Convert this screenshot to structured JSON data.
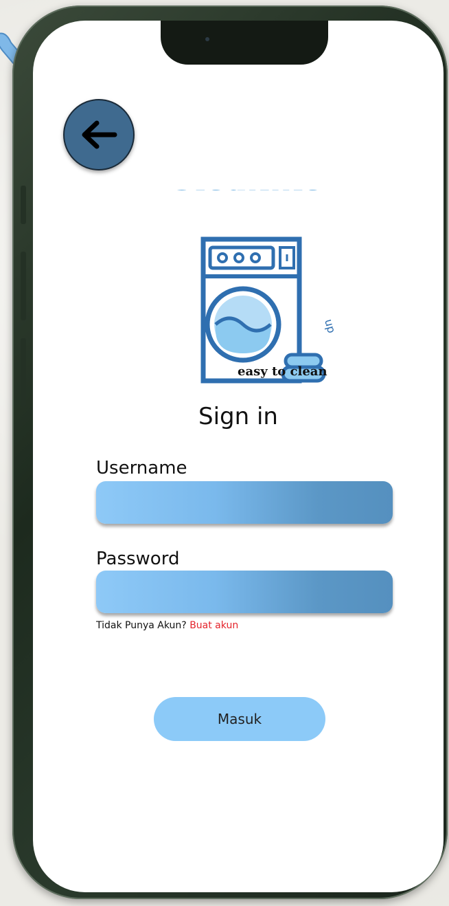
{
  "logo": {
    "wordmark": "Cleanme",
    "wordmark_suffix": "up",
    "tagline": "easy to clean"
  },
  "form": {
    "title": "Sign in",
    "username_label": "Username",
    "username_value": "",
    "password_label": "Password",
    "password_value": "",
    "no_account_text": "Tidak Punya Akun?",
    "create_account_link": "Buat akun",
    "submit_label": "Masuk"
  },
  "icons": {
    "back": "arrow-left-icon",
    "notch_camera": "camera-icon",
    "decor": "pointer-decor-icon"
  },
  "colors": {
    "accent_blue": "#8ccaf8",
    "back_button": "#3f6a8f",
    "link_red": "#e4232b",
    "logo_blue": "#2f6fb0",
    "logo_light_blue": "#8ccaf0"
  }
}
